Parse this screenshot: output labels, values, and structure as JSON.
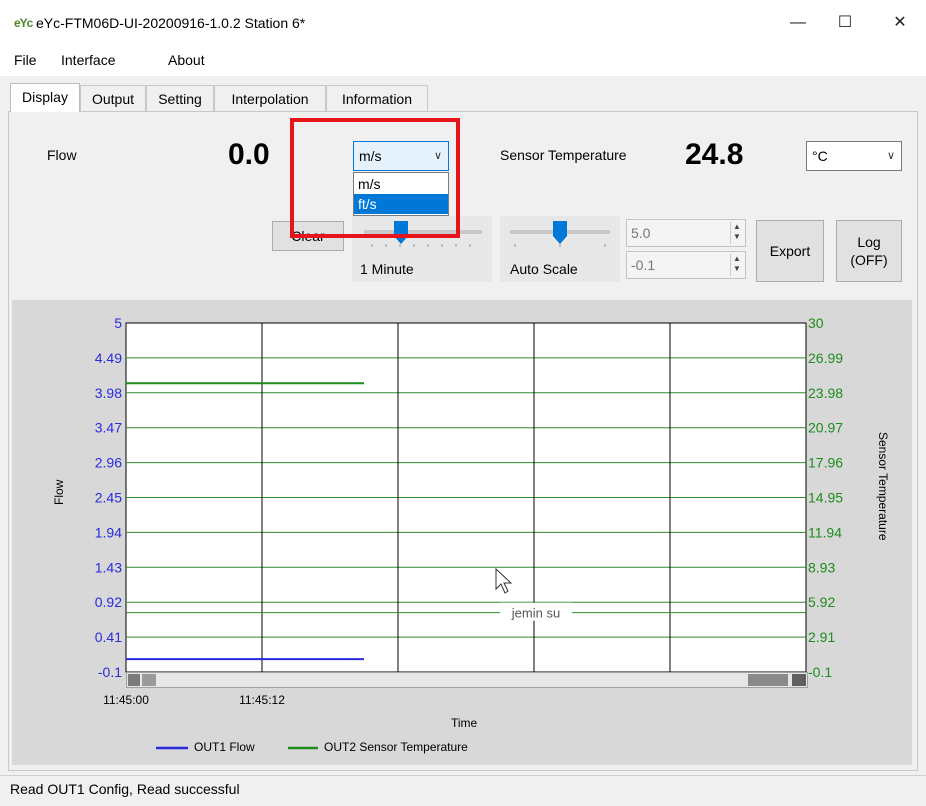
{
  "window": {
    "logo": "eYc",
    "title": "eYc-FTM06D-UI-20200916-1.0.2  Station 6*",
    "minimize": "—",
    "maximize": "☐",
    "close": "✕"
  },
  "menu": {
    "items": [
      "File",
      "Interface",
      "About"
    ]
  },
  "tabs": [
    "Display",
    "Output",
    "Setting",
    "Interpolation",
    "Information"
  ],
  "display": {
    "flow_label": "Flow",
    "flow_value": "0.0",
    "flow_unit_selected": "m/s",
    "flow_unit_options": [
      "m/s",
      "ft/s"
    ],
    "flow_unit_highlighted": "ft/s",
    "temp_label": "Sensor Temperature",
    "temp_value": "24.8",
    "temp_unit_selected": "°C",
    "clear_label": "Clear",
    "time_span_label": "1 Minute",
    "scale_label": "Auto Scale",
    "max_value": "5.0",
    "min_value": "-0.1",
    "export_label": "Export",
    "log_label_line1": "Log",
    "log_label_line2": "(OFF)"
  },
  "chart_data": {
    "type": "line",
    "xlabel": "Time",
    "ylabel": "Flow",
    "y2label": "Sensor Temperature",
    "x_ticks": [
      "11:45:00",
      "11:45:12"
    ],
    "y_ticks": [
      "5",
      "4.49",
      "3.98",
      "3.47",
      "2.96",
      "2.45",
      "1.94",
      "1.43",
      "0.92",
      "0.41",
      "-0.1"
    ],
    "y2_ticks": [
      "30",
      "26.99",
      "23.98",
      "20.97",
      "17.96",
      "14.95",
      "11.94",
      "8.93",
      "5.92",
      "2.91",
      "-0.1"
    ],
    "ylim": [
      -0.1,
      5
    ],
    "y2lim": [
      -0.1,
      30
    ],
    "grid": true,
    "legend_position": "bottom",
    "watermark": "jemin  su",
    "series": [
      {
        "name": "OUT1 Flow",
        "axis": "left",
        "color": "#2a2adf",
        "values": [
          0.0,
          0.0
        ]
      },
      {
        "name": "OUT2 Sensor Temperature",
        "axis": "right",
        "color": "#1e8c1e",
        "values": [
          24.8,
          24.8
        ]
      }
    ]
  },
  "status": {
    "text": "Read OUT1 Config,   Read successful"
  }
}
